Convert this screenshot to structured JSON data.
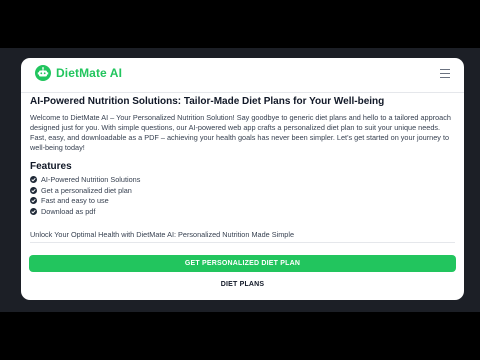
{
  "app": {
    "brand": "DietMate AI"
  },
  "main": {
    "title": "AI-Powered Nutrition Solutions: Tailor-Made Diet Plans for Your Well-being",
    "intro": "Welcome to DietMate AI – Your Personalized Nutrition Solution! Say goodbye to generic diet plans and hello to a tailored approach designed just for you. With simple questions, our AI-powered web app crafts a personalized diet plan to suit your unique needs. Fast, easy, and downloadable as a PDF – achieving your health goals has never been simpler. Let's get started on your journey to well-being today!",
    "features_heading": "Features",
    "features": [
      "AI-Powered Nutrition Solutions",
      "Get a personalized diet plan",
      "Fast and easy to use",
      "Download as pdf"
    ],
    "tagline": "Unlock Your Optimal Health with DietMate AI: Personalized Nutrition Made Simple",
    "cta_label": "GET PERSONALIZED DIET PLAN",
    "secondary_label": "DIET PLANS"
  },
  "colors": {
    "accent": "#22c55e",
    "text_dark": "#111827",
    "text_body": "#374151",
    "page_bg": "#1c1f26"
  },
  "icons": {
    "logo": "robot-icon",
    "menu": "hamburger-menu-icon",
    "feature_bullet": "check-circle-icon"
  }
}
